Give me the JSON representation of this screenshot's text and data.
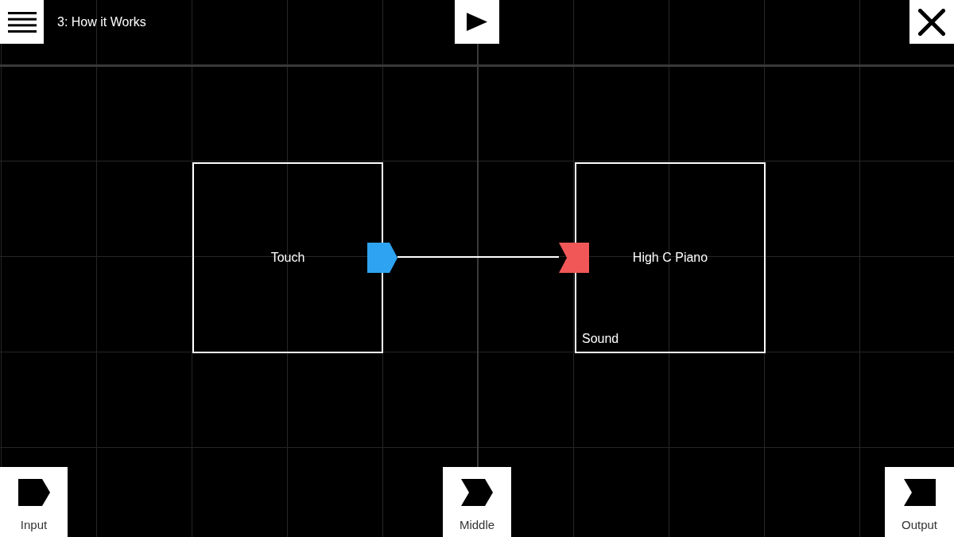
{
  "toolbar": {
    "title": "3: How it Works"
  },
  "nodes": [
    {
      "label": "Touch",
      "port": {
        "kind": "output",
        "color": "#2ea3f2",
        "connected": true
      }
    },
    {
      "label": "High C Piano",
      "category": "Sound",
      "port": {
        "kind": "input",
        "color": "#f25757"
      }
    }
  ],
  "palette": [
    {
      "label": "Input",
      "kind": "input"
    },
    {
      "label": "Middle",
      "kind": "middle"
    },
    {
      "label": "Output",
      "kind": "output"
    }
  ]
}
